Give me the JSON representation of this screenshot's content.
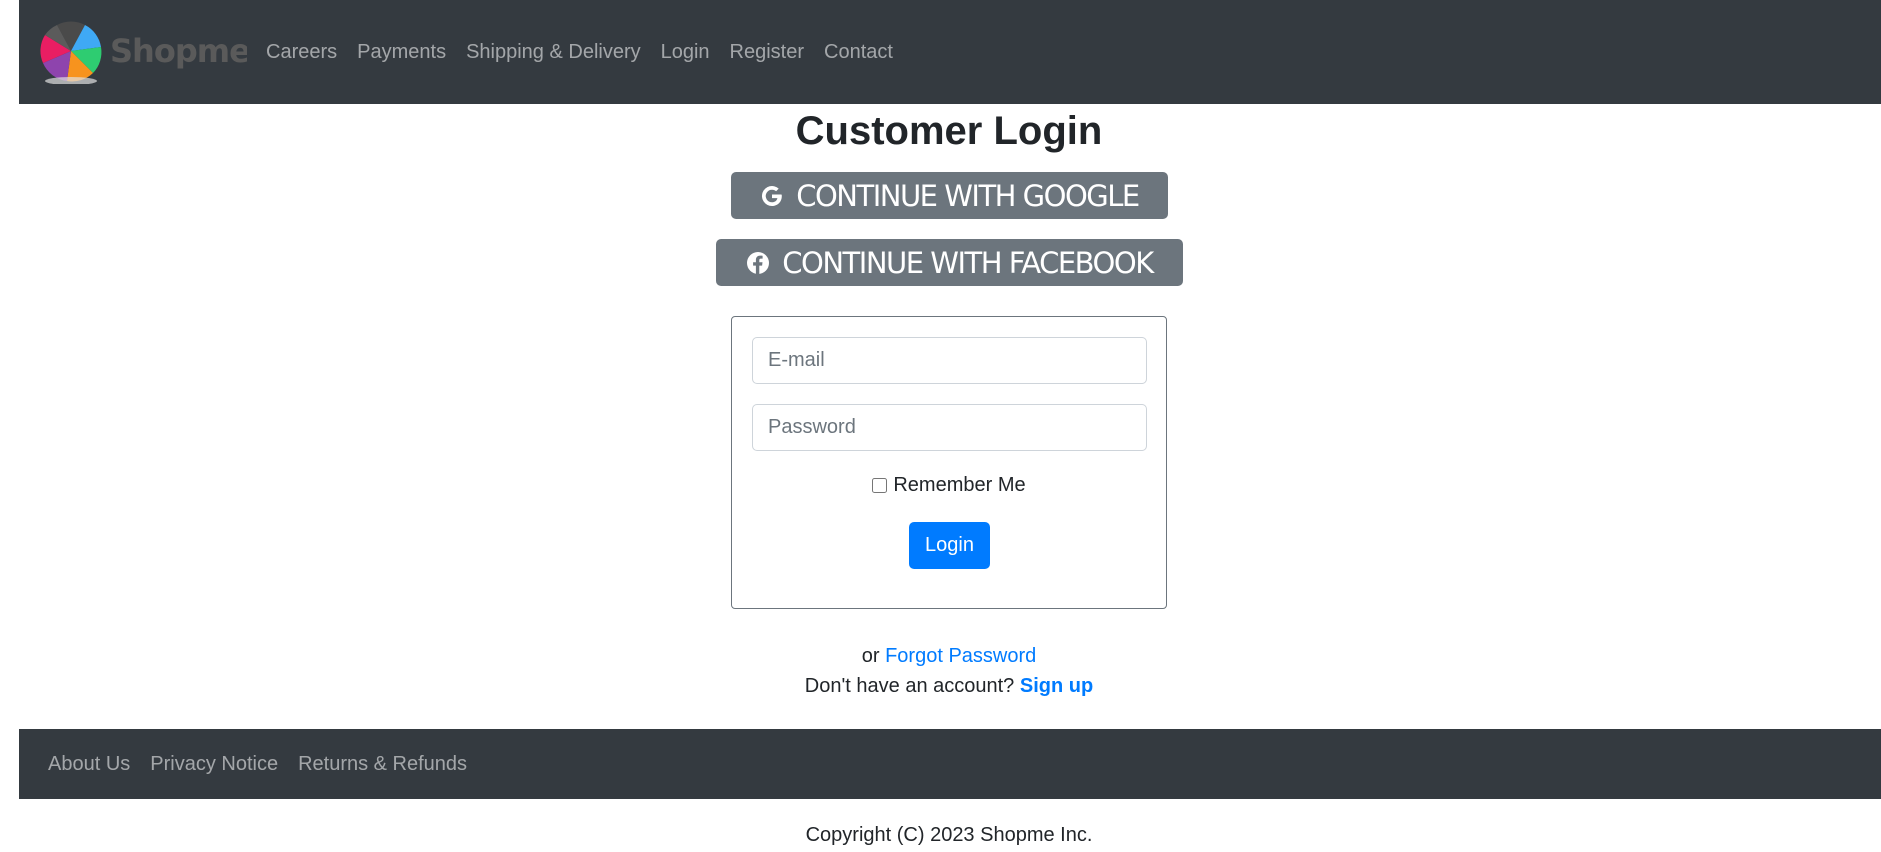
{
  "header": {
    "logo_text": "Shopme",
    "nav_links": [
      "Careers",
      "Payments",
      "Shipping & Delivery",
      "Login",
      "Register",
      "Contact"
    ]
  },
  "main": {
    "title": "Customer Login",
    "google_button_label": "CONTINUE WITH GOOGLE",
    "facebook_button_label": "CONTINUE WITH FACEBOOK",
    "form": {
      "email_placeholder": "E-mail",
      "password_placeholder": "Password",
      "remember_label": "Remember Me",
      "remember_checked": false,
      "login_button_label": "Login"
    },
    "forgot": {
      "prefix": "or",
      "link": "Forgot Password"
    },
    "signup": {
      "prefix": "Don't have an account?",
      "link": "Sign up"
    }
  },
  "footer": {
    "links": [
      "About Us",
      "Privacy Notice",
      "Returns & Refunds"
    ],
    "copyright": "Copyright (C) 2023 Shopme Inc."
  },
  "colors": {
    "navbar_bg": "#343a40",
    "social_button_bg": "#6c757d",
    "primary": "#007bff"
  },
  "icons": {
    "google": "google-icon",
    "facebook": "facebook-icon"
  }
}
